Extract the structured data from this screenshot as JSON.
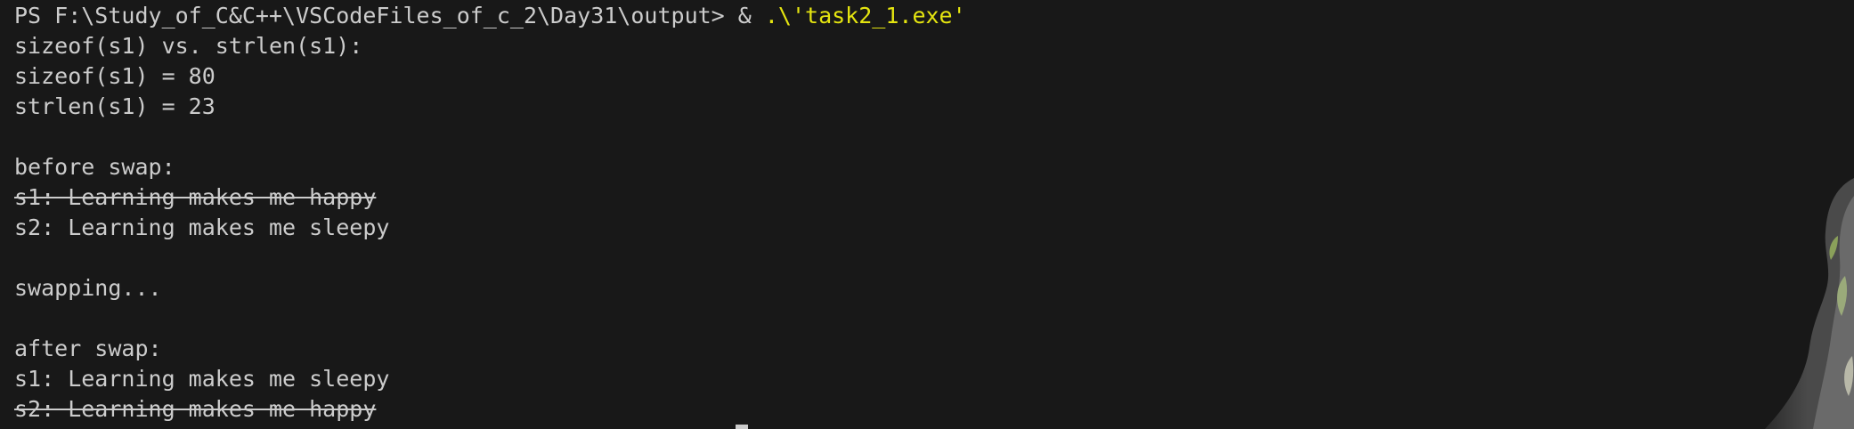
{
  "terminal": {
    "prompt": "PS F:\\Study_of_C&C++\\VSCodeFiles_of_c_2\\Day31\\output> & ",
    "command": ".\\'task2_1.exe'",
    "output": [
      "sizeof(s1) vs. strlen(s1):",
      "sizeof(s1) = 80",
      "strlen(s1) = 23",
      "",
      "before swap:",
      "s1: Learning makes me happy",
      "s2: Learning makes me sleepy",
      "",
      "swapping...",
      "",
      "after swap:",
      "s1: Learning makes me sleepy",
      "s2: Learning makes me happy"
    ]
  },
  "colors": {
    "background": "#181818",
    "foreground": "#cccccc",
    "command": "#e5e510"
  },
  "background_image_icon": "anime-character-background"
}
